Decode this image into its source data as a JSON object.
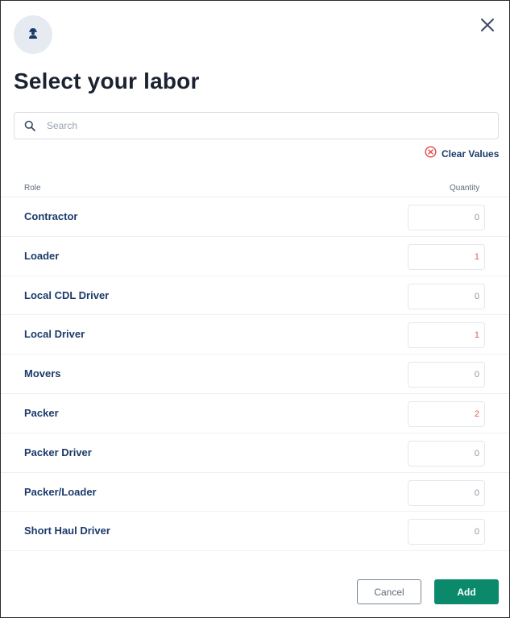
{
  "dialog": {
    "title": "Select your labor",
    "avatar_icon": "worker-icon",
    "close_icon": "close-icon"
  },
  "search": {
    "placeholder": "Search",
    "value": "",
    "icon": "search-icon"
  },
  "clear_values": {
    "label": "Clear Values",
    "icon": "circle-x-icon",
    "icon_color": "#e04848"
  },
  "list": {
    "role_header": "Role",
    "quantity_header": "Quantity",
    "rows": [
      {
        "role": "Contractor",
        "quantity": "0"
      },
      {
        "role": "Loader",
        "quantity": "1"
      },
      {
        "role": "Local CDL Driver",
        "quantity": "0"
      },
      {
        "role": "Local Driver",
        "quantity": "1"
      },
      {
        "role": "Movers",
        "quantity": "0"
      },
      {
        "role": "Packer",
        "quantity": "2"
      },
      {
        "role": "Packer Driver",
        "quantity": "0"
      },
      {
        "role": "Packer/Loader",
        "quantity": "0"
      },
      {
        "role": "Short Haul Driver",
        "quantity": "0"
      }
    ]
  },
  "footer": {
    "cancel_label": "Cancel",
    "add_label": "Add"
  },
  "colors": {
    "primary_green": "#0a8a6a",
    "navy_text": "#1b3a6b",
    "nonzero_quantity": "#e05a5a"
  }
}
